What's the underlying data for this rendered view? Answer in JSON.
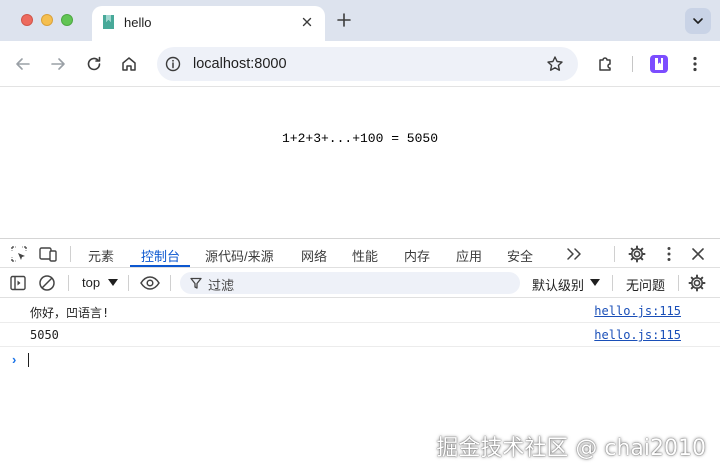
{
  "window": {
    "tab_title": "hello",
    "url": "localhost:8000"
  },
  "page": {
    "content_text": "1+2+3+...+100 = 5050"
  },
  "devtools": {
    "tabs": [
      {
        "label": "元素"
      },
      {
        "label": "控制台",
        "active": true
      },
      {
        "label": "源代码/来源"
      },
      {
        "label": "网络"
      },
      {
        "label": "性能"
      },
      {
        "label": "内存"
      },
      {
        "label": "应用"
      },
      {
        "label": "安全"
      }
    ],
    "console": {
      "context": "top",
      "filter_placeholder": "过滤",
      "levels_label": "默认级别",
      "issues_label": "无问题",
      "messages": [
        {
          "text": "你好，凹语言!",
          "source": "hello.js:115"
        },
        {
          "text": "5050",
          "source": "hello.js:115"
        }
      ]
    }
  },
  "watermark": "掘金技术社区 @ chai2010",
  "colors": {
    "accent": "#0b57d0",
    "tabstrip_bg": "#dde3ee",
    "link": "#1a4fb8"
  },
  "icons": [
    "tab-favicon",
    "close-icon",
    "plus-icon",
    "chevron-down-icon",
    "back-arrow-icon",
    "forward-arrow-icon",
    "reload-icon",
    "home-icon",
    "info-icon",
    "star-icon",
    "extensions-icon",
    "profile-extension-icon",
    "more-vert-icon",
    "inspect-icon",
    "device-toolbar-icon",
    "more-tabs-icon",
    "settings-gear-icon",
    "sidebar-toggle-icon",
    "clear-console-icon",
    "eye-icon",
    "filter-icon",
    "prompt-chevron-icon"
  ]
}
